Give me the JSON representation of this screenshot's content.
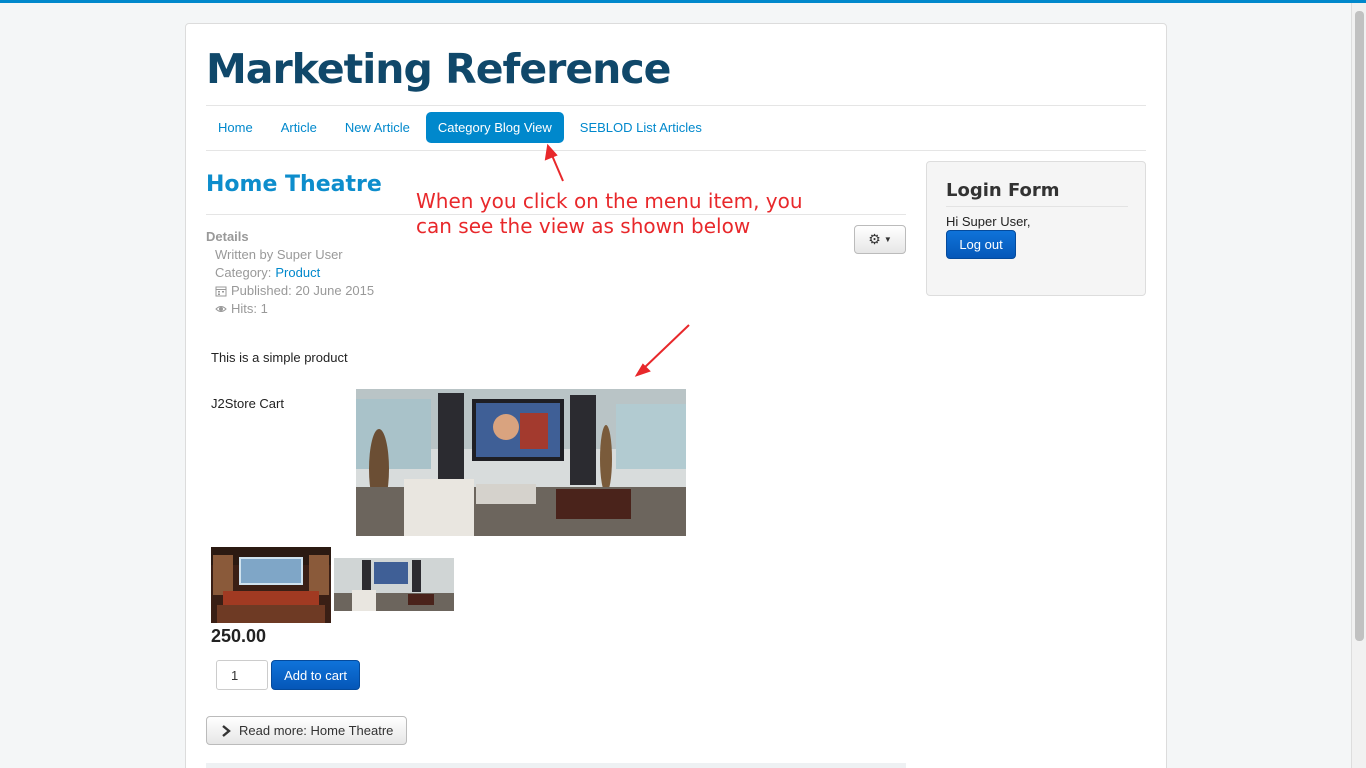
{
  "site": {
    "title": "Marketing Reference"
  },
  "nav": {
    "items": [
      {
        "label": "Home"
      },
      {
        "label": "Article"
      },
      {
        "label": "New Article"
      },
      {
        "label": "Category Blog View"
      },
      {
        "label": "SEBLOD List Articles"
      }
    ],
    "active": "Category Blog View"
  },
  "annotation": {
    "line1": "When you click on the menu item, you",
    "line2": "can see the view as shown below"
  },
  "article": {
    "title": "Home Theatre",
    "details_label": "Details",
    "written_by": "Written by Super User",
    "category_prefix": "Category: ",
    "category": "Product",
    "published": "Published: 20 June 2015",
    "hits": "Hits: 1",
    "intro": "This is a simple product",
    "cart_label": "J2Store Cart",
    "price": "250.00",
    "quantity": "1",
    "add_to_cart": "Add to cart",
    "read_more": "Read more: Home Theatre"
  },
  "login": {
    "title": "Login Form",
    "greeting": "Hi Super User,",
    "logout_label": "Log out"
  },
  "colors": {
    "link": "#0088cc",
    "title": "#10486a",
    "annotation": "#e8282b",
    "button_primary": "#0557b8"
  },
  "icons": [
    "gear-icon",
    "caret-down-icon",
    "calendar-icon",
    "eye-icon",
    "chevron-right-icon"
  ]
}
